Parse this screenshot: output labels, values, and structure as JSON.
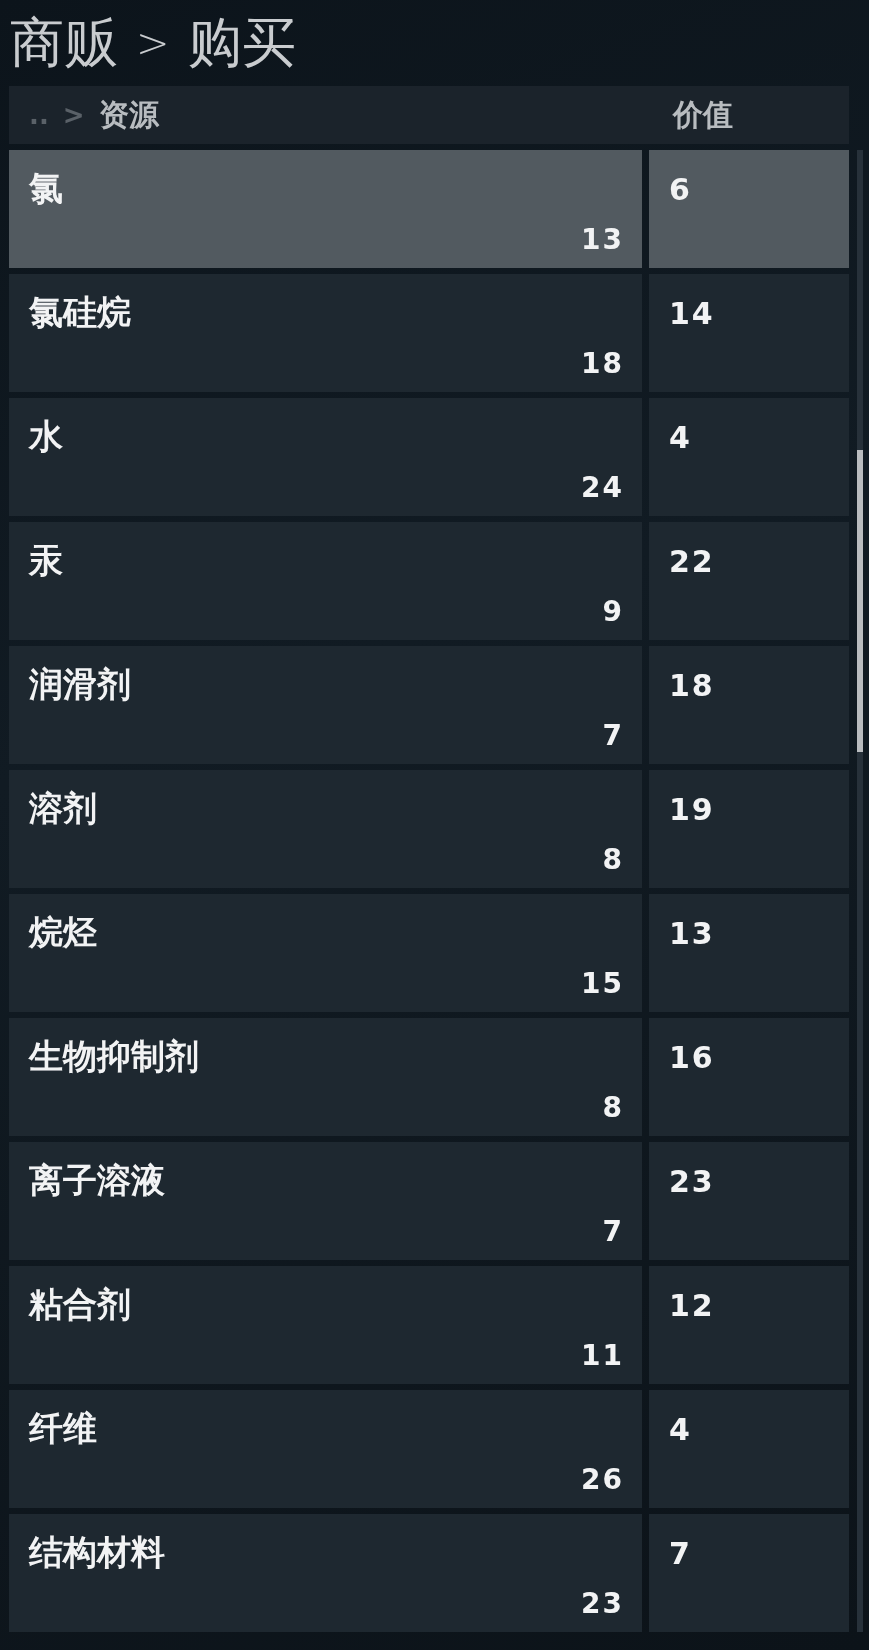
{
  "title": {
    "parts": [
      "商贩",
      ">",
      "购买"
    ]
  },
  "table": {
    "breadcrumb": [
      "..",
      ">"
    ],
    "columns": [
      "资源",
      "价值"
    ],
    "rows": [
      {
        "name": "氯",
        "quantity": "13",
        "value": "6",
        "selected": true
      },
      {
        "name": "氯硅烷",
        "quantity": "18",
        "value": "14",
        "selected": false
      },
      {
        "name": "水",
        "quantity": "24",
        "value": "4",
        "selected": false
      },
      {
        "name": "汞",
        "quantity": "9",
        "value": "22",
        "selected": false
      },
      {
        "name": "润滑剂",
        "quantity": "7",
        "value": "18",
        "selected": false
      },
      {
        "name": "溶剂",
        "quantity": "8",
        "value": "19",
        "selected": false
      },
      {
        "name": "烷烃",
        "quantity": "15",
        "value": "13",
        "selected": false
      },
      {
        "name": "生物抑制剂",
        "quantity": "8",
        "value": "16",
        "selected": false
      },
      {
        "name": "离子溶液",
        "quantity": "7",
        "value": "23",
        "selected": false
      },
      {
        "name": "粘合剂",
        "quantity": "11",
        "value": "12",
        "selected": false
      },
      {
        "name": "纤维",
        "quantity": "26",
        "value": "4",
        "selected": false
      },
      {
        "name": "结构材料",
        "quantity": "23",
        "value": "7",
        "selected": false
      }
    ]
  }
}
